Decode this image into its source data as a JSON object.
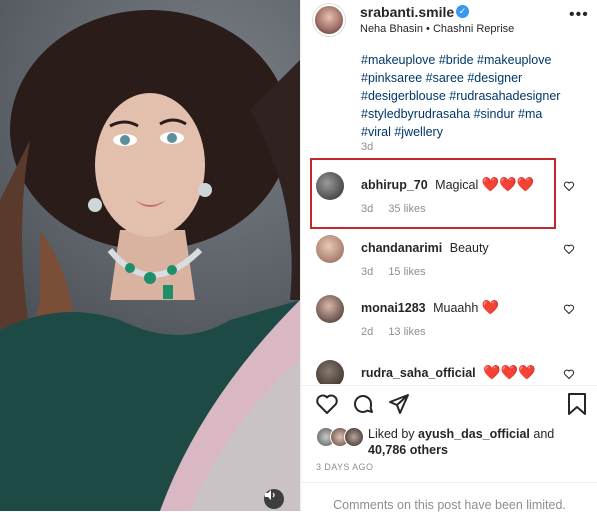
{
  "post": {
    "username": "srabanti.smile",
    "verified_glyph": "✓",
    "music": "Neha Bhasin • Chashni Reprise",
    "more_glyph": "•••",
    "caption_lines": [
      "#makeuplove #bride #makeuplove",
      "#pinksaree #saree #designer",
      "#desigerblouse #rudrasahadesigner",
      "#styledbyrudrasaha #sindur #ma",
      "#viral #jwellery"
    ],
    "caption_age": "3d"
  },
  "comments": [
    {
      "user": "abhirup_70",
      "text": "Magical",
      "hearts": "❤️❤️❤️",
      "age": "3d",
      "likes": "35 likes"
    },
    {
      "user": "chandanarimi",
      "text": "Beauty",
      "hearts": "",
      "age": "3d",
      "likes": "15 likes"
    },
    {
      "user": "monai1283",
      "text": "Muaahh",
      "hearts": "❤️",
      "age": "2d",
      "likes": "13 likes"
    },
    {
      "user": "rudra_saha_official",
      "text": "",
      "hearts": "❤️❤️❤️",
      "age": "",
      "likes": ""
    }
  ],
  "likes": {
    "prefix": "Liked by",
    "by_user": "ayush_das_official",
    "and": "and",
    "others_count": "40,786 others"
  },
  "timestamp": "3 DAYS AGO",
  "comments_limited": "Comments on this post have been limited.",
  "icons": {
    "like": "heart-outline-icon",
    "comment": "comment-icon",
    "share": "paper-plane-icon",
    "save": "bookmark-icon",
    "sound": "speaker-icon"
  },
  "colors": {
    "highlight_border": "#c0282e",
    "heart_red": "#ed4956",
    "hashtag_blue": "#00376b",
    "verified_blue": "#3897f0",
    "muted_gray": "#8e8e8e"
  }
}
